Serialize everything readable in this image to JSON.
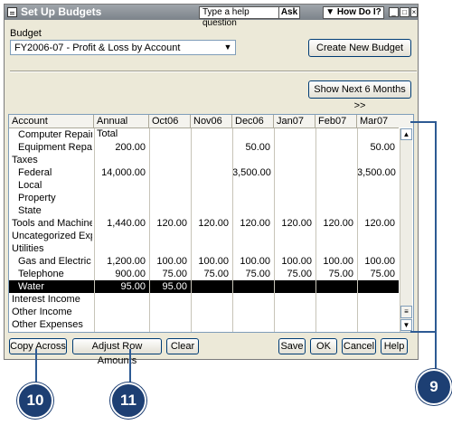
{
  "window": {
    "title": "Set Up Budgets",
    "help_placeholder": "Type a help question",
    "ask_label": "Ask",
    "howdoi_label": "How Do I?"
  },
  "budget": {
    "label": "Budget",
    "selected": "FY2006-07 - Profit & Loss by Account"
  },
  "buttons": {
    "create_new": "Create New Budget",
    "show_next": "Show Next 6 Months >>",
    "copy_across": "Copy Across",
    "adjust_row": "Adjust Row Amounts",
    "clear": "Clear",
    "save": "Save",
    "ok": "OK",
    "cancel": "Cancel",
    "help": "Help"
  },
  "table": {
    "columns": [
      "Account",
      "Annual Total",
      "Oct06",
      "Nov06",
      "Dec06",
      "Jan07",
      "Feb07",
      "Mar07"
    ],
    "rows": [
      {
        "account": "Computer Repairs",
        "indent": true,
        "cells": [
          "",
          "",
          "",
          "",
          "",
          "",
          ""
        ]
      },
      {
        "account": "Equipment Repairs",
        "indent": true,
        "cells": [
          "200.00",
          "",
          "",
          "50.00",
          "",
          "",
          "50.00"
        ]
      },
      {
        "account": "Taxes",
        "indent": false,
        "cells": [
          "",
          "",
          "",
          "",
          "",
          "",
          ""
        ]
      },
      {
        "account": "Federal",
        "indent": true,
        "cells": [
          "14,000.00",
          "",
          "",
          "3,500.00",
          "",
          "",
          "3,500.00"
        ]
      },
      {
        "account": "Local",
        "indent": true,
        "cells": [
          "",
          "",
          "",
          "",
          "",
          "",
          ""
        ]
      },
      {
        "account": "Property",
        "indent": true,
        "cells": [
          "",
          "",
          "",
          "",
          "",
          "",
          ""
        ]
      },
      {
        "account": "State",
        "indent": true,
        "cells": [
          "",
          "",
          "",
          "",
          "",
          "",
          ""
        ]
      },
      {
        "account": "Tools and Machinery",
        "indent": false,
        "cells": [
          "1,440.00",
          "120.00",
          "120.00",
          "120.00",
          "120.00",
          "120.00",
          "120.00"
        ]
      },
      {
        "account": "Uncategorized Exp...",
        "indent": false,
        "cells": [
          "",
          "",
          "",
          "",
          "",
          "",
          ""
        ]
      },
      {
        "account": "Utilities",
        "indent": false,
        "cells": [
          "",
          "",
          "",
          "",
          "",
          "",
          ""
        ]
      },
      {
        "account": "Gas and Electric",
        "indent": true,
        "cells": [
          "1,200.00",
          "100.00",
          "100.00",
          "100.00",
          "100.00",
          "100.00",
          "100.00"
        ]
      },
      {
        "account": "Telephone",
        "indent": true,
        "cells": [
          "900.00",
          "75.00",
          "75.00",
          "75.00",
          "75.00",
          "75.00",
          "75.00"
        ]
      },
      {
        "account": "Water",
        "indent": true,
        "selected": true,
        "cells": [
          "95.00",
          "95.00",
          "",
          "",
          "",
          "",
          ""
        ]
      },
      {
        "account": "Interest Income",
        "indent": false,
        "cells": [
          "",
          "",
          "",
          "",
          "",
          "",
          ""
        ]
      },
      {
        "account": "Other Income",
        "indent": false,
        "cells": [
          "",
          "",
          "",
          "",
          "",
          "",
          ""
        ]
      },
      {
        "account": "Other Expenses",
        "indent": false,
        "cells": [
          "",
          "",
          "",
          "",
          "",
          "",
          ""
        ]
      }
    ]
  },
  "callouts": [
    "10",
    "11",
    "9"
  ],
  "colors": {
    "callout": "#1d3f73",
    "selected_row": "#000000"
  }
}
